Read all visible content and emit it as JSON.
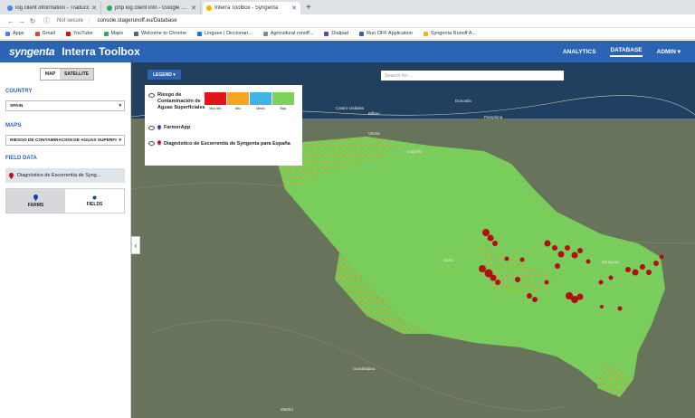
{
  "browser": {
    "tabs": [
      {
        "title": "log client information - Traducc",
        "color": "#4285f4"
      },
      {
        "title": "php log client info - Google Sea",
        "color": "#34a853"
      },
      {
        "title": "Interra Toolbox - Syngenta",
        "color": "#f4b400"
      }
    ],
    "security_label": "Not secure",
    "url": "console.stagerunoff.eu/Database",
    "bookmarks": [
      {
        "label": "Apps",
        "color": "#4285f4"
      },
      {
        "label": "Gmail",
        "color": "#ea4335"
      },
      {
        "label": "YouTube",
        "color": "#ff0000"
      },
      {
        "label": "Maps",
        "color": "#34a853"
      },
      {
        "label": "Welcome to Chrome",
        "color": "#5f6368"
      },
      {
        "label": "Linguee | Diccionari...",
        "color": "#1a73e8"
      },
      {
        "label": "Agricultural runoff...",
        "color": "#888888"
      },
      {
        "label": "Dialpad",
        "color": "#6b3fa0"
      },
      {
        "label": "Run OFF Application",
        "color": "#2b63b5"
      },
      {
        "label": "Syngenta Runoff A...",
        "color": "#f4b400"
      }
    ]
  },
  "app": {
    "logo": "syngenta",
    "title": "Interra Toolbox",
    "nav": [
      "ANALYTICS",
      "DATABASE",
      "ADMIN ▾"
    ],
    "accent": "#2b63b5"
  },
  "sidebar": {
    "map_toggle": {
      "map": "MAP",
      "satellite": "SATELLITE"
    },
    "country_label": "COUNTRY",
    "country_value": "SPAIN",
    "maps_label": "MAPS",
    "maps_value": "RIESGO DE CONTAMINACIÓN DE AGUAS SUPERFICIALES",
    "field_data_label": "FIELD DATA",
    "field_item": "Diagnóstico de Escorrentía de Syng...",
    "farms_tab": "FARMS",
    "fields_tab": "FIELDS"
  },
  "map": {
    "legend_button": "LEGEND ▾",
    "search_placeholder": "Search for ...",
    "legend": {
      "layer1": "Riesgo de Contaminación de Aguas Superficiales",
      "classes": [
        {
          "label": "Muy alto",
          "color": "#e3131b"
        },
        {
          "label": "Alto",
          "color": "#f7a521"
        },
        {
          "label": "Medio",
          "color": "#3fb4e6"
        },
        {
          "label": "Bajo",
          "color": "#7bd35a"
        }
      ],
      "layer2": "FarmerApp",
      "layer3": "Diagnóstico de Escorrentía de Syngenta para España"
    },
    "place_labels": [
      "Castro-Urdiales",
      "Bilbao",
      "Donostia",
      "Vitoria",
      "Burgos",
      "Logroño",
      "Pamplona",
      "Zaragoza",
      "Madrid",
      "Guadalajara",
      "Soria"
    ]
  }
}
